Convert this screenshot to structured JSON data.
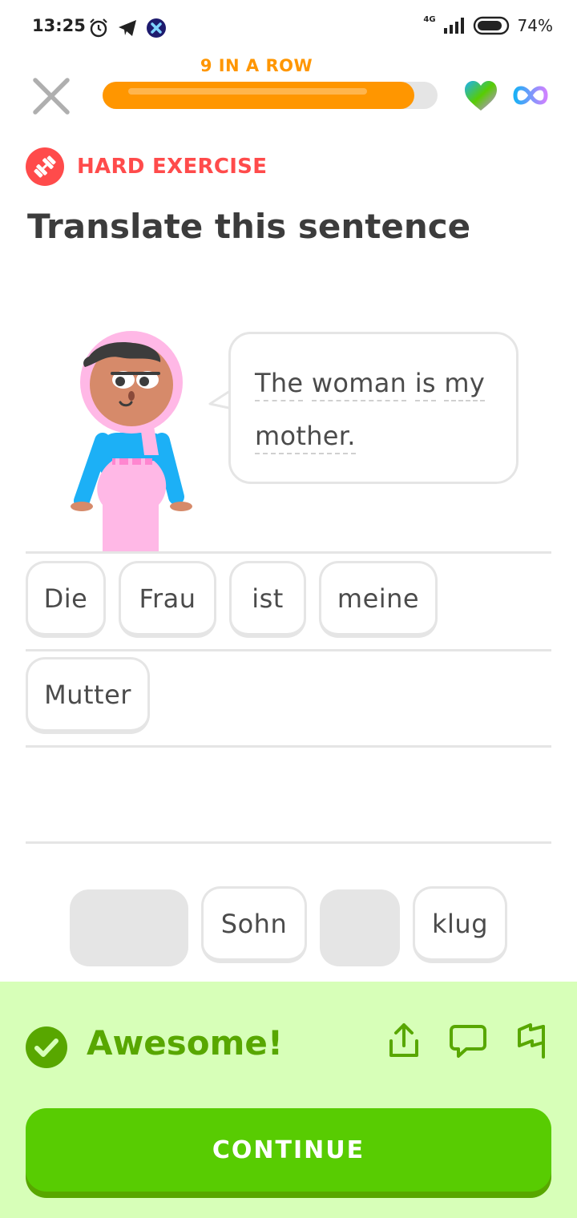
{
  "status_bar": {
    "time": "13:25",
    "network": "4G",
    "battery": "74%",
    "icons": [
      "alarm-icon",
      "telegram-icon",
      "app-icon",
      "signal-icon",
      "battery-icon"
    ]
  },
  "header": {
    "streak_label": "9 IN A ROW",
    "progress_percent": 93,
    "close_icon": "close-icon",
    "hearts_icon": "heart-icon",
    "hearts_value": "infinity"
  },
  "exercise": {
    "badge_label": "HARD EXERCISE",
    "title": "Translate this sentence",
    "prompt_words": [
      "The",
      "woman",
      "is",
      "my",
      "mother."
    ]
  },
  "answer": {
    "selected_words": [
      "Die",
      "Frau",
      "ist",
      "meine",
      "Mutter"
    ]
  },
  "word_bank": {
    "chips": [
      "",
      "Sohn",
      "",
      "klug"
    ]
  },
  "feedback": {
    "title": "Awesome!",
    "continue_label": "CONTINUE",
    "icons": [
      "share-icon",
      "comment-icon",
      "flag-icon"
    ]
  },
  "colors": {
    "streak": "#ff9600",
    "hard": "#ff4b4b",
    "success_bg": "#d7ffb8",
    "success_text": "#58a700",
    "button": "#58cc02"
  }
}
